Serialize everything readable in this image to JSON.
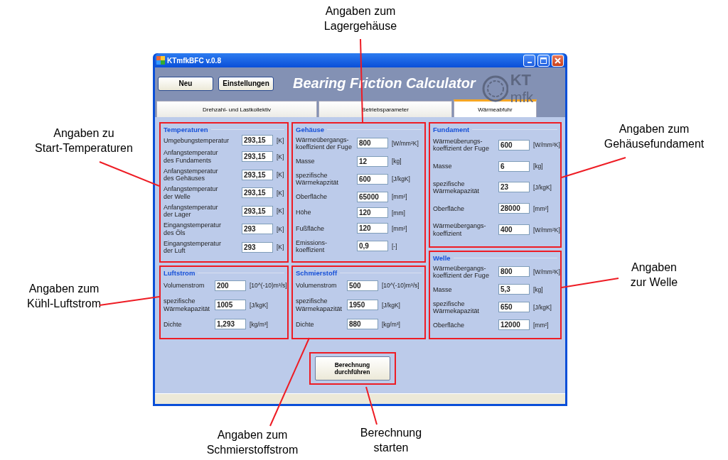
{
  "window": {
    "title": "KTmfkBFC v.0.8"
  },
  "toolbar": {
    "buttons": [
      "Neu",
      "Einstellungen"
    ]
  },
  "app_title": "Bearing Friction Calculator",
  "logo": {
    "text_top": "KT",
    "text_bottom": "mfk"
  },
  "tabs": [
    {
      "label": "Drehzahl- und Lastkollektiv",
      "selected": false
    },
    {
      "label": "Betriebsparameter",
      "selected": false
    },
    {
      "label": "Wärmeabfuhr",
      "selected": true
    }
  ],
  "columns": [
    [
      {
        "title": "Temperaturen",
        "fields": [
          {
            "label": "Umgebungstemperatur",
            "value": "293,15",
            "unit": "[K]"
          },
          {
            "label": "Anfangstemperatur\ndes Fundaments",
            "value": "293,15",
            "unit": "[K]"
          },
          {
            "label": "Anfangstemperatur\ndes Gehäuses",
            "value": "293,15",
            "unit": "[K]"
          },
          {
            "label": "Anfangstemperatur\nder Welle",
            "value": "293,15",
            "unit": "[K]"
          },
          {
            "label": "Anfangstemperatur\nder Lager",
            "value": "293,15",
            "unit": "[K]"
          },
          {
            "label": "Eingangstemperatur\ndes Öls",
            "value": "293",
            "unit": "[K]"
          },
          {
            "label": "Eingangstemperatur\nder Luft",
            "value": "293",
            "unit": "[K]"
          }
        ]
      },
      {
        "title": "Luftstrom",
        "fields": [
          {
            "label": "Volumenstrom",
            "value": "200",
            "unit": "[10^(-10)m³/s]"
          },
          {
            "label": "spezifische\nWärmekapazität",
            "value": "1005",
            "unit": "[J/kgK]"
          },
          {
            "label": "Dichte",
            "value": "1,293",
            "unit": "[kg/m³]"
          }
        ]
      }
    ],
    [
      {
        "title": "Gehäuse",
        "fields": [
          {
            "label": "Wärmeübergangs-\nkoeffizient der Fuge",
            "value": "800",
            "unit": "[W/mm²K]"
          },
          {
            "label": "Masse",
            "value": "12",
            "unit": "[kg]"
          },
          {
            "label": "spezifische\nWärmekapzität",
            "value": "600",
            "unit": "[J/kgK]"
          },
          {
            "label": "Oberfläche",
            "value": "65000",
            "unit": "[mm²]"
          },
          {
            "label": "Höhe",
            "value": "120",
            "unit": "[mm]"
          },
          {
            "label": "Fußfläche",
            "value": "120",
            "unit": "[mm²]"
          },
          {
            "label": "Emissions-\nkoeffizient",
            "value": "0,9",
            "unit": "[-]"
          }
        ]
      },
      {
        "title": "Schmierstoff",
        "fields": [
          {
            "label": "Volumenstrom",
            "value": "500",
            "unit": "[10^(-10)m³/s]"
          },
          {
            "label": "spezifische\nWärmekapazität",
            "value": "1950",
            "unit": "[J/kgK]"
          },
          {
            "label": "Dichte",
            "value": "880",
            "unit": "[kg/m³]"
          }
        ]
      }
    ],
    [
      {
        "title": "Fundament",
        "fields": [
          {
            "label": "Wärmeüberungs-\nkoeffizient der Fuge",
            "value": "600",
            "unit": "[W/mm²K]"
          },
          {
            "label": "Masse",
            "value": "6",
            "unit": "[kg]"
          },
          {
            "label": "spezifische\nWärmekapazität",
            "value": "23",
            "unit": "[J/kgK]"
          },
          {
            "label": "Oberfläche",
            "value": "28000",
            "unit": "[mm²]"
          },
          {
            "label": "Wärmeübergangs-\nkoeffizient",
            "value": "400",
            "unit": "[W/mm²K]"
          }
        ]
      },
      {
        "title": "Welle",
        "fields": [
          {
            "label": "Wärmeübergangs-\nkoeffizient der Fuge",
            "value": "800",
            "unit": "[W/mm²K]"
          },
          {
            "label": "Masse",
            "value": "5,3",
            "unit": "[kg]"
          },
          {
            "label": "spezifische\nWärmekapazität",
            "value": "650",
            "unit": "[J/kgK]"
          },
          {
            "label": "Oberfläche",
            "value": "12000",
            "unit": "[mm²]"
          }
        ]
      }
    ]
  ],
  "calculate_button": "Berechnung\ndurchführen",
  "annotations": [
    {
      "text": "Angaben zum\nLagergehäuse"
    },
    {
      "text": "Angaben zu\nStart-Temperaturen"
    },
    {
      "text": "Angaben zum\nGehäusefundament"
    },
    {
      "text": "Angaben zum\nKühl-Luftstrom"
    },
    {
      "text": "Angaben\nzur Welle"
    },
    {
      "text": "Angaben zum\nSchmierstoffstrom"
    },
    {
      "text": "Berechnung\nstarten"
    }
  ]
}
